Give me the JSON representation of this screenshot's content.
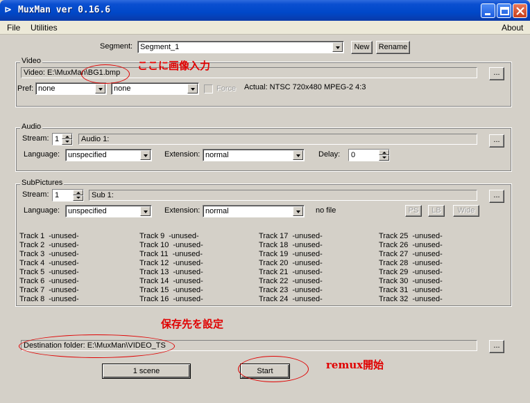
{
  "window": {
    "title": "MuxMan ver 0.16.6"
  },
  "menu": {
    "file": "File",
    "utilities": "Utilities",
    "about": "About"
  },
  "segment": {
    "label": "Segment:",
    "value": "Segment_1",
    "new_label": "New",
    "rename_label": "Rename"
  },
  "video": {
    "group_title": "Video",
    "path": "Video: E:\\MuxMan\\BG1.bmp",
    "browse_label": "...",
    "pref_label": "Pref:",
    "pref1": "none",
    "pref2": "none",
    "force_label": "Force",
    "actual": "Actual: NTSC 720x480  MPEG-2  4:3"
  },
  "audio": {
    "group_title": "Audio",
    "stream_label": "Stream:",
    "stream_value": "1",
    "stream_name": "Audio 1:",
    "browse_label": "...",
    "language_label": "Language:",
    "language_value": "unspecified",
    "extension_label": "Extension:",
    "extension_value": "normal",
    "delay_label": "Delay:",
    "delay_value": "0"
  },
  "subpictures": {
    "group_title": "SubPictures",
    "stream_label": "Stream:",
    "stream_value": "1",
    "stream_name": "Sub 1:",
    "browse_label": "...",
    "language_label": "Language:",
    "language_value": "unspecified",
    "extension_label": "Extension:",
    "extension_value": "normal",
    "file_status": "no file",
    "ps_label": "PS",
    "lb_label": "LB",
    "wide_label": "Wide",
    "tracks": [
      {
        "name": "Track 1",
        "status": "-unused-"
      },
      {
        "name": "Track 2",
        "status": "-unused-"
      },
      {
        "name": "Track 3",
        "status": "-unused-"
      },
      {
        "name": "Track 4",
        "status": "-unused-"
      },
      {
        "name": "Track 5",
        "status": "-unused-"
      },
      {
        "name": "Track 6",
        "status": "-unused-"
      },
      {
        "name": "Track 7",
        "status": "-unused-"
      },
      {
        "name": "Track 8",
        "status": "-unused-"
      },
      {
        "name": "Track 9",
        "status": "-unused-"
      },
      {
        "name": "Track 10",
        "status": "-unused-"
      },
      {
        "name": "Track 11",
        "status": "-unused-"
      },
      {
        "name": "Track 12",
        "status": "-unused-"
      },
      {
        "name": "Track 13",
        "status": "-unused-"
      },
      {
        "name": "Track 14",
        "status": "-unused-"
      },
      {
        "name": "Track 15",
        "status": "-unused-"
      },
      {
        "name": "Track 16",
        "status": "-unused-"
      },
      {
        "name": "Track 17",
        "status": "-unused-"
      },
      {
        "name": "Track 18",
        "status": "-unused-"
      },
      {
        "name": "Track 19",
        "status": "-unused-"
      },
      {
        "name": "Track 20",
        "status": "-unused-"
      },
      {
        "name": "Track 21",
        "status": "-unused-"
      },
      {
        "name": "Track 22",
        "status": "-unused-"
      },
      {
        "name": "Track 23",
        "status": "-unused-"
      },
      {
        "name": "Track 24",
        "status": "-unused-"
      },
      {
        "name": "Track 25",
        "status": "-unused-"
      },
      {
        "name": "Track 26",
        "status": "-unused-"
      },
      {
        "name": "Track 27",
        "status": "-unused-"
      },
      {
        "name": "Track 28",
        "status": "-unused-"
      },
      {
        "name": "Track 29",
        "status": "-unused-"
      },
      {
        "name": "Track 30",
        "status": "-unused-"
      },
      {
        "name": "Track 31",
        "status": "-unused-"
      },
      {
        "name": "Track 32",
        "status": "-unused-"
      }
    ]
  },
  "destination": {
    "path": "Destination folder: E:\\MuxMan\\VIDEO_TS",
    "browse_label": "..."
  },
  "actions": {
    "scene_label": "1 scene",
    "start_label": "Start"
  },
  "annotations": {
    "image_input": "ここに画像入力",
    "save_location": "保存先を設定",
    "remux_start": "remux開始",
    "color": "#e00000"
  }
}
